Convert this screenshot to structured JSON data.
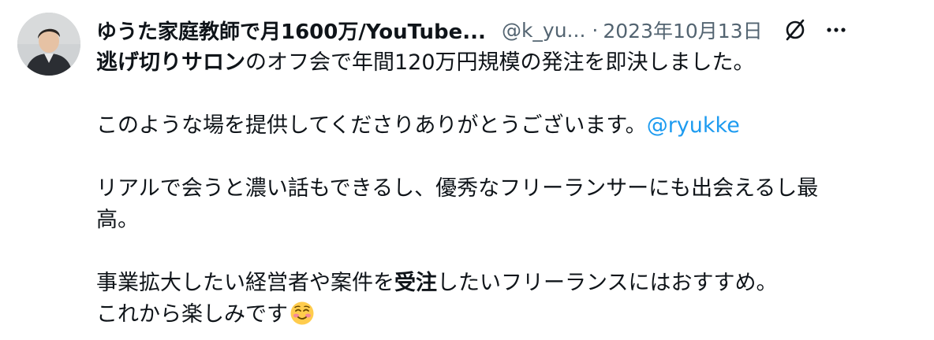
{
  "tweet": {
    "author_name": "ゆうた家庭教師で月1600万/YouTube...",
    "handle": "@k_yu...",
    "separator": "·",
    "date": "2023年10月13日",
    "line1_bold": "逃げ切りサロン",
    "line1_rest": "のオフ会で年間120万円規模の発注を即決しました。",
    "line2_text": "このような場を提供してくださりありがとうございます。",
    "line2_mention": "@ryukke",
    "line3_a": "リアルで会うと濃い話もできるし、優秀なフリーランサーにも出会えるし最",
    "line3_b": "高。",
    "line4_pre": "事業拡大したい経営者や案件を",
    "line4_bold": "受注",
    "line4_post": "したいフリーランスにはおすすめ。",
    "line5_text": "これから楽しみです",
    "emoji": "smiling-face-with-blush"
  },
  "icons": {
    "grok": "grok-icon",
    "more": "more-horizontal-icon"
  },
  "colors": {
    "text": "#0f1419",
    "secondary": "#536471",
    "link": "#1d9bf0"
  }
}
